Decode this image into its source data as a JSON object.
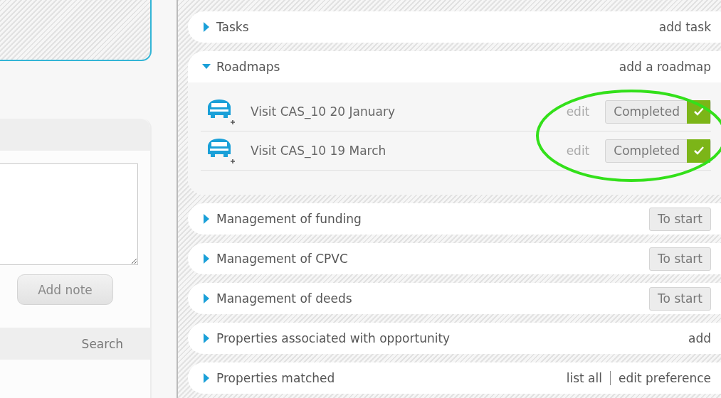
{
  "left_panel": {
    "note_button": "Add note",
    "search_label": "Search"
  },
  "sections": [
    {
      "title": "Tasks",
      "expanded": false,
      "actions": [
        "add task"
      ]
    },
    {
      "title": "Roadmaps",
      "expanded": true,
      "actions": [
        "add a roadmap"
      ],
      "items": [
        {
          "title": "Visit CAS_10 20 January",
          "edit": "edit",
          "status": "Completed",
          "done": true
        },
        {
          "title": "Visit CAS_10 19 March",
          "edit": "edit",
          "status": "Completed",
          "done": true
        }
      ]
    },
    {
      "title": "Management of funding",
      "expanded": false,
      "status": "To start"
    },
    {
      "title": "Management of CPVC",
      "expanded": false,
      "status": "To start"
    },
    {
      "title": "Management of deeds",
      "expanded": false,
      "status": "To start"
    },
    {
      "title": "Properties associated with opportunity",
      "expanded": false,
      "actions": [
        "add"
      ]
    },
    {
      "title": "Properties matched",
      "expanded": false,
      "actions": [
        "list all",
        "edit preference"
      ]
    }
  ]
}
